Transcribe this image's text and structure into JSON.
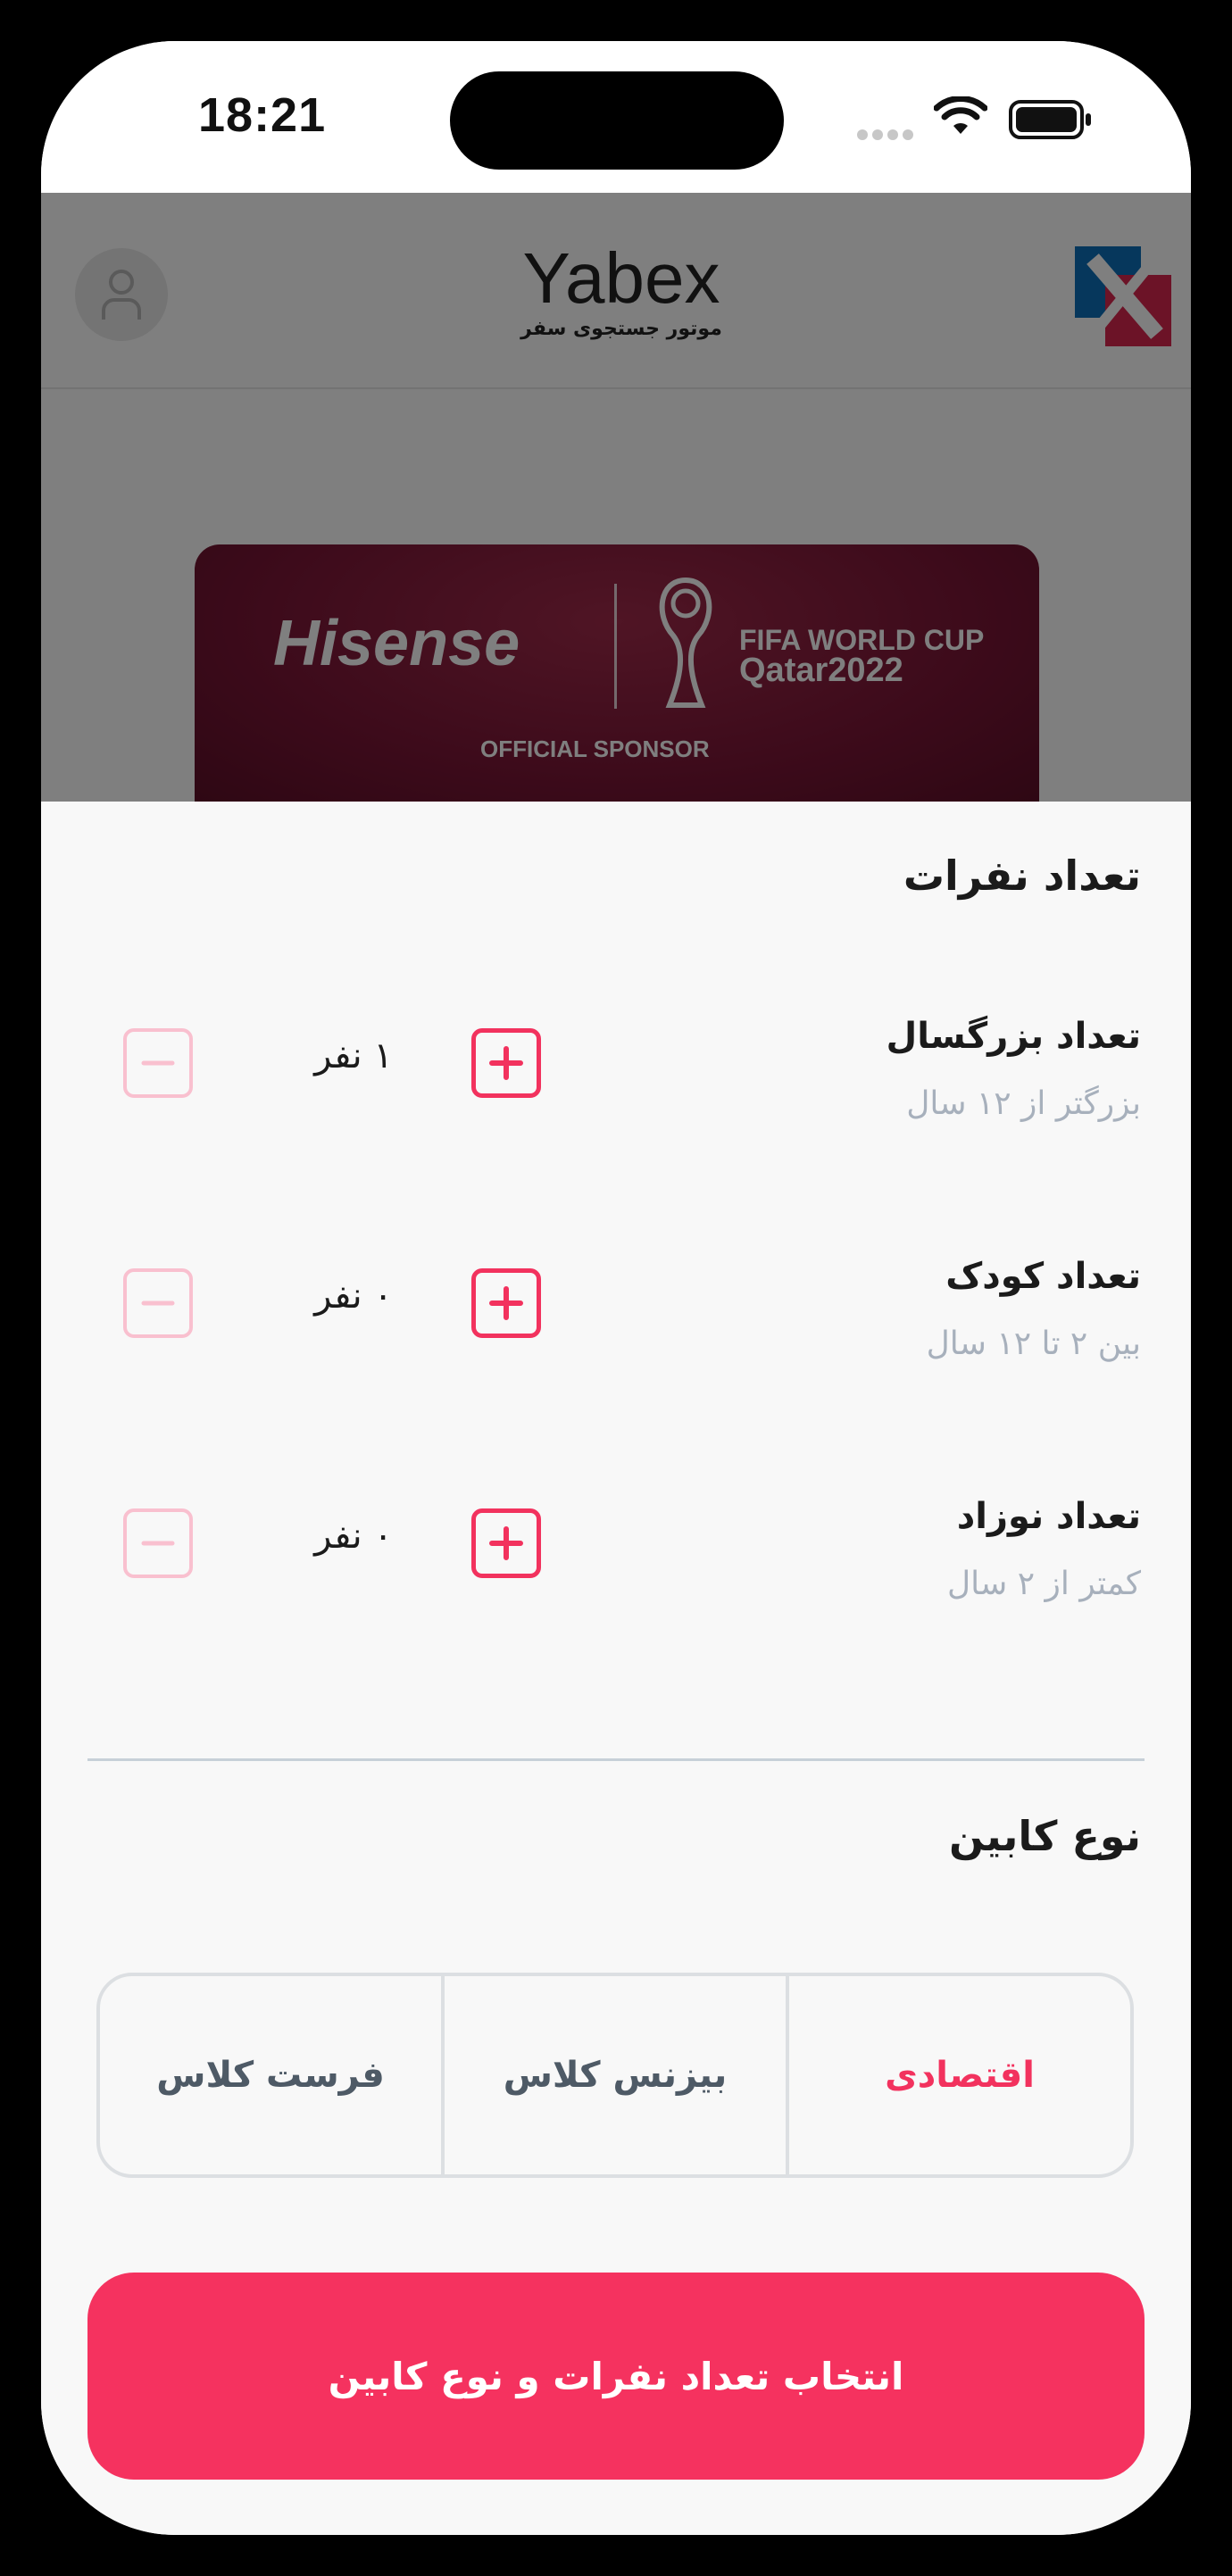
{
  "status_bar": {
    "time": "18:21"
  },
  "header": {
    "brand_name": "Yabex",
    "brand_subtitle": "موتور جستجوی سفر"
  },
  "banner": {
    "left_text": "Hisense",
    "right_line1": "FIFA WORLD CUP",
    "right_line2": "Qatar2022",
    "bottom_text": "OFFICIAL SPONSOR"
  },
  "passengers": {
    "title": "تعداد نفرات",
    "rows": [
      {
        "label": "تعداد بزرگسال",
        "sub": "بزرگتر از ۱۲ سال",
        "count": "۱  نفر"
      },
      {
        "label": "تعداد کودک",
        "sub": "بین ۲ تا ۱۲ سال",
        "count": "۰  نفر"
      },
      {
        "label": "تعداد نوزاد",
        "sub": "کمتر از ۲ سال",
        "count": "۰  نفر"
      }
    ]
  },
  "cabin": {
    "title": "نوع کابین",
    "options": [
      "اقتصادی",
      "بیزنس کلاس",
      "فرست کلاس"
    ],
    "selected": "اقتصادی"
  },
  "cta_label": "انتخاب تعداد نفرات و نوع کابین",
  "colors": {
    "accent": "#f5325f",
    "muted": "#a7b0bc"
  }
}
